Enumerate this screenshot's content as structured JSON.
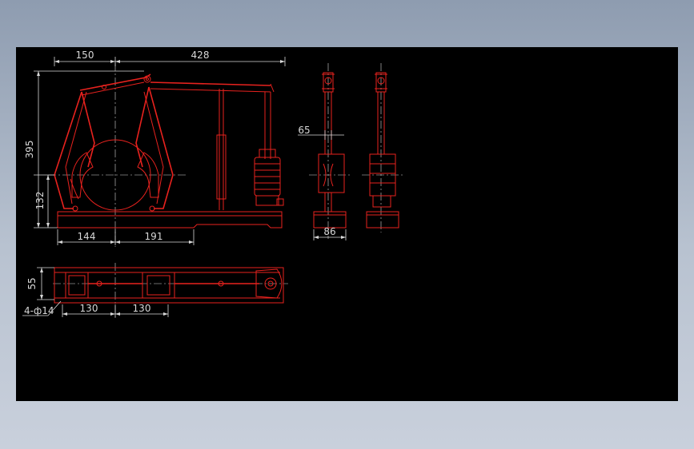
{
  "drawing": {
    "background": "#000000",
    "line_color": "#e8221e",
    "dimension_color": "#d8d8d8",
    "front_view": {
      "dim_top_left": "150",
      "dim_top_right": "428",
      "dim_height_total": "395",
      "dim_height_lower": "132",
      "dim_bottom_left": "144",
      "dim_bottom_right": "191"
    },
    "side_view": {
      "dim_width": "65",
      "dim_base": "86"
    },
    "top_view": {
      "dim_height": "55",
      "dim_left": "130",
      "dim_right": "130",
      "hole_callout": "4-ф14"
    }
  }
}
